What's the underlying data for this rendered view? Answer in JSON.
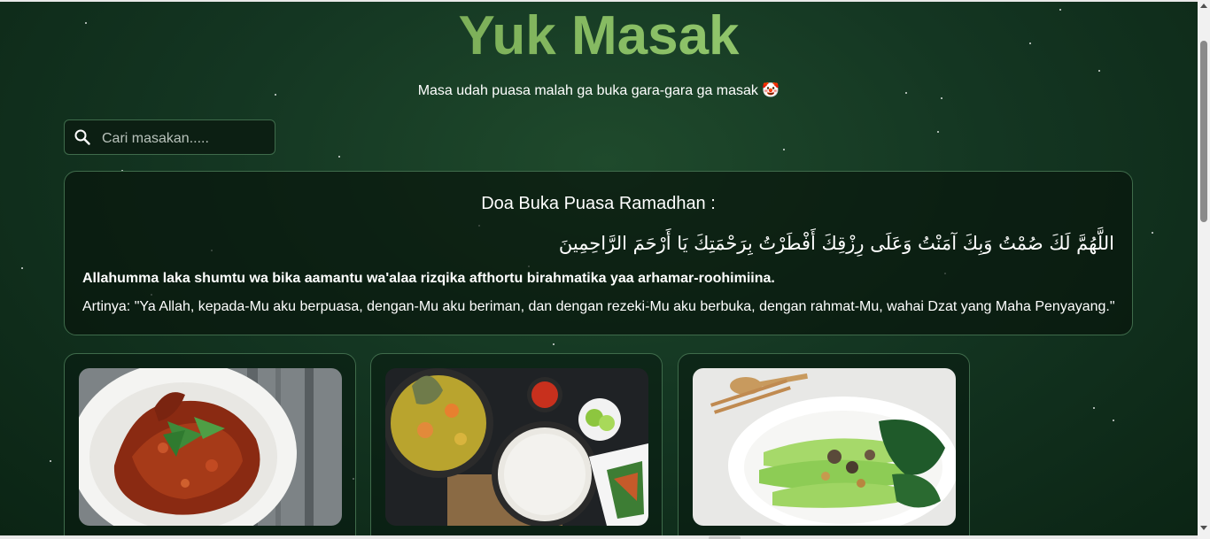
{
  "header": {
    "title": "Yuk Masak",
    "subtitle": "Masa udah puasa malah ga buka gara-gara ga masak 🤡"
  },
  "search": {
    "placeholder": "Cari masakan.....",
    "value": "",
    "icon": "search-icon"
  },
  "doa": {
    "title": "Doa Buka Puasa Ramadhan :",
    "arabic": "اللَّهُمَّ لَكَ صُمْتُ وَبِكَ آمَنْتُ وَعَلَى رِزْقِكَ أَفْطَرْتُ بِرَحْمَتِكَ يَا أَرْحَمَ الرَّاحِمِينَ",
    "latin": "Allahumma laka shumtu wa bika aamantu wa'alaa rizqika afthortu birahmatika yaa arhamar-roohimiina.",
    "meaning": "Artinya: \"Ya Allah, kepada-Mu aku berpuasa, dengan-Mu aku beriman, dan dengan rezeki-Mu aku berbuka, dengan rahmat-Mu, wahai Dzat yang Maha Penyayang.\""
  },
  "cards": [
    {
      "image": "spicy-fried-chicken-photo"
    },
    {
      "image": "fish-curry-porridge-photo"
    },
    {
      "image": "bok-choy-mushroom-photo"
    }
  ],
  "colors": {
    "background": "#143622",
    "title_gradient_start": "#5b8a3a",
    "title_gradient_end": "#a6d07c",
    "border": "#3f6b4b"
  }
}
